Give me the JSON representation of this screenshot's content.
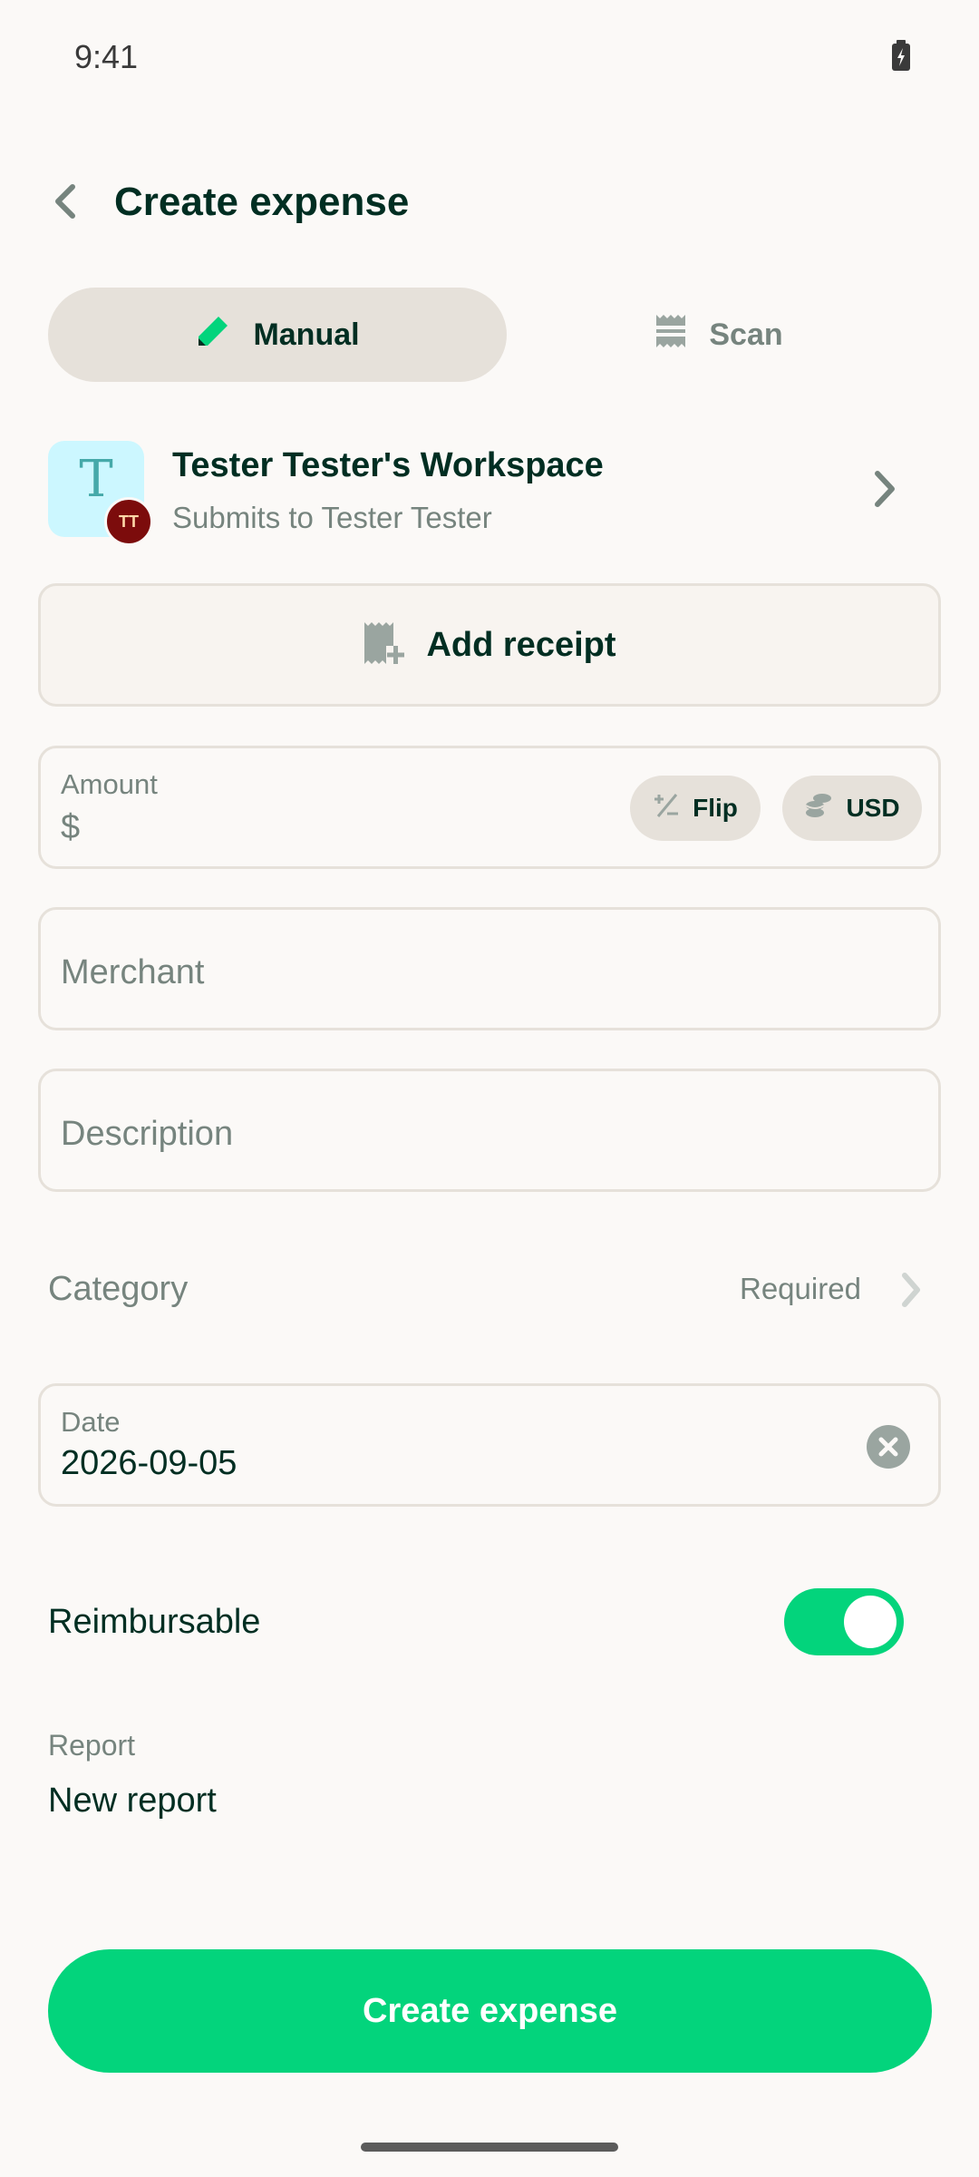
{
  "status_bar": {
    "time": "9:41",
    "battery_icon": "battery-charging-icon"
  },
  "header": {
    "back_icon": "chevron-left-icon",
    "title": "Create expense"
  },
  "tabs": [
    {
      "label": "Manual",
      "icon": "pencil-icon",
      "selected": true
    },
    {
      "label": "Scan",
      "icon": "receipt-scan-icon",
      "selected": false
    }
  ],
  "workspace": {
    "avatar_letter": "T",
    "user_initials": "TT",
    "name": "Tester Tester's Workspace",
    "subtitle": "Submits to Tester Tester"
  },
  "receipt": {
    "label": "Add receipt",
    "icon": "receipt-plus-icon"
  },
  "amount": {
    "label": "Amount",
    "currency_symbol": "$",
    "value": "",
    "flip_label": "Flip",
    "currency_label": "USD"
  },
  "merchant": {
    "placeholder": "Merchant",
    "value": ""
  },
  "description": {
    "placeholder": "Description",
    "value": ""
  },
  "category": {
    "label": "Category",
    "status": "Required"
  },
  "date": {
    "label": "Date",
    "value": "2026-09-05"
  },
  "reimbursable": {
    "label": "Reimbursable",
    "enabled": true
  },
  "report": {
    "label": "Report",
    "value": "New report"
  },
  "submit": {
    "label": "Create expense"
  },
  "colors": {
    "accent_green": "#03d47c",
    "text_primary": "#002e22",
    "text_secondary": "#76847e",
    "border": "#e6e1da",
    "background": "#fbf9f7"
  }
}
